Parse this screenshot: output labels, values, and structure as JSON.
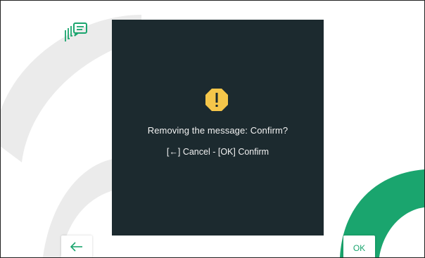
{
  "dialog": {
    "icon": "warning-icon",
    "message": "Removing the message: Confirm?",
    "hint": "[←] Cancel - [OK] Confirm"
  },
  "header": {
    "icon": "messages-icon"
  },
  "footer": {
    "back_icon": "arrow-left-icon",
    "ok_label": "OK"
  },
  "colors": {
    "accent": "#1aa56e",
    "dialog_background": "#1c2a2f",
    "warning": "#f5c64a",
    "decoration": "#ebebeb"
  }
}
